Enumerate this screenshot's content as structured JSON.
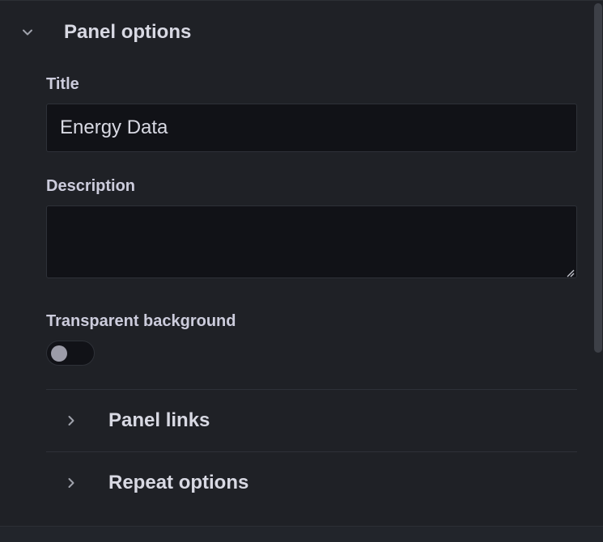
{
  "panel_options": {
    "header_label": "Panel options",
    "expanded": true,
    "title_label": "Title",
    "title_value": "Energy Data",
    "description_label": "Description",
    "description_value": "",
    "transparent_label": "Transparent background",
    "transparent_enabled": false
  },
  "sub_sections": [
    {
      "label": "Panel links",
      "expanded": false
    },
    {
      "label": "Repeat options",
      "expanded": false
    }
  ],
  "icons": {
    "expanded": "chevron-down-icon",
    "collapsed": "chevron-right-icon",
    "resize": "resize-grip-icon"
  },
  "colors": {
    "background": "#1f2126",
    "input_background": "#111217",
    "text": "#ccccdc",
    "border": "#2e3138"
  }
}
